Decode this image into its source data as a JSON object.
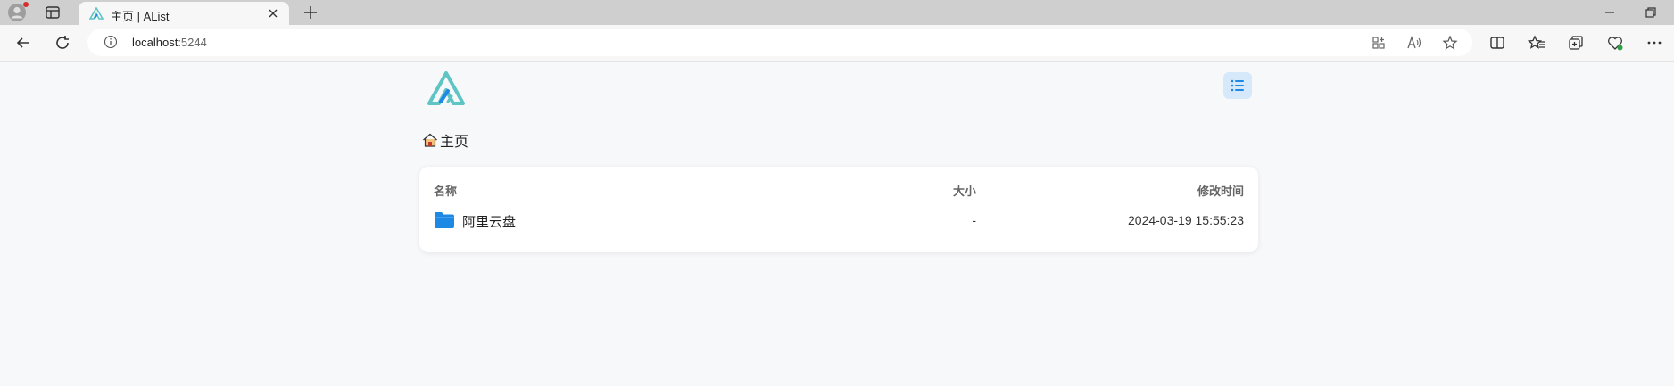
{
  "browser": {
    "tab": {
      "title": "主页 | AList"
    },
    "address": {
      "host": "localhost",
      "port": ":5244"
    }
  },
  "page": {
    "breadcrumb": {
      "label": "主页"
    },
    "table": {
      "headers": {
        "name": "名称",
        "size": "大小",
        "modified": "修改时间"
      },
      "rows": [
        {
          "name": "阿里云盘",
          "size": "-",
          "modified": "2024-03-19 15:55:23"
        }
      ]
    }
  },
  "colors": {
    "accent": "#1e88e5",
    "logo": "#5fc4c4",
    "menu_bg": "#d6e9fb"
  },
  "icons": {
    "profile": "profile-avatar-icon",
    "tab_favicon": "alist-logo-icon",
    "menu": "list-icon",
    "breadcrumb": "home-icon",
    "row": "folder-icon"
  }
}
